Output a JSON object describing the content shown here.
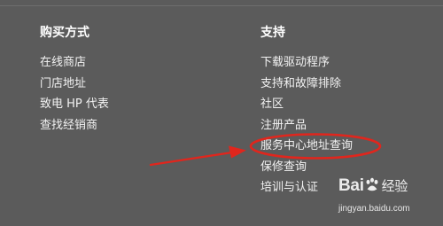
{
  "buy": {
    "title": "购买方式",
    "items": [
      {
        "label": "在线商店"
      },
      {
        "label": "门店地址"
      },
      {
        "label": "致电 HP 代表"
      },
      {
        "label": "查找经销商"
      }
    ]
  },
  "support": {
    "title": "支持",
    "items": [
      {
        "label": "下载驱动程序"
      },
      {
        "label": "支持和故障排除"
      },
      {
        "label": "社区"
      },
      {
        "label": "注册产品"
      },
      {
        "label": "服务中心地址查询"
      },
      {
        "label": "保修查询"
      },
      {
        "label": "培训与认证"
      }
    ]
  },
  "annotation": {
    "color": "#e0261d",
    "highlighted_item": "服务中心地址查询"
  },
  "watermark": {
    "logo": "Bai",
    "logo_suffix": "经验",
    "url": "jingyan.baidu.com"
  }
}
